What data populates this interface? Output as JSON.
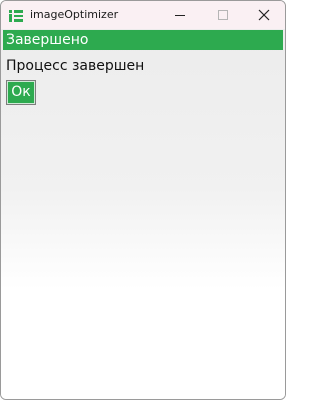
{
  "window": {
    "title": "imageOptimizer",
    "app_icon": "image-optimizer-app-icon",
    "controls": {
      "minimize_icon": "minimize-icon",
      "maximize_icon": "maximize-icon",
      "close_icon": "close-icon"
    }
  },
  "status": {
    "label": "Завершено",
    "color": "#2daa4f"
  },
  "message": {
    "text": "Процесс завершен"
  },
  "ok_button": {
    "label": "Ок",
    "color": "#2daa4f"
  }
}
